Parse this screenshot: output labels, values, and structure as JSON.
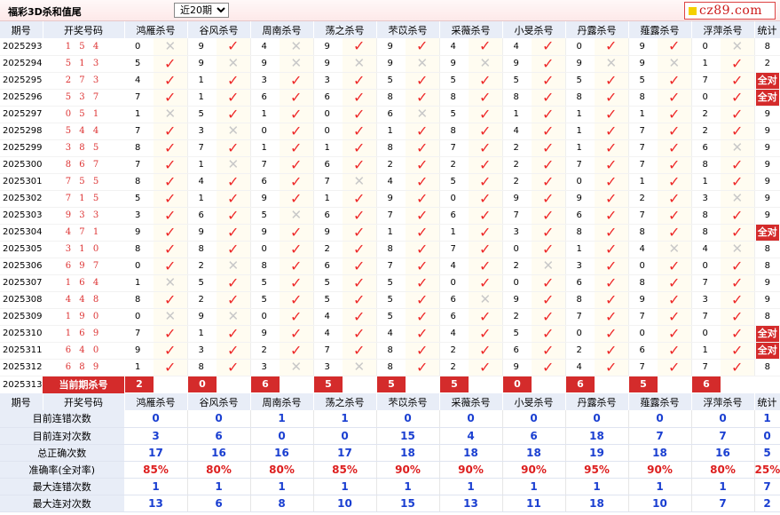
{
  "header": {
    "title": "福彩3D杀和值尾",
    "period_selected": "近20期",
    "logo_text": "cz89.com"
  },
  "columns": {
    "issue": "期号",
    "draw": "开奖号码",
    "killers": [
      "鸿雁杀号",
      "谷风杀号",
      "周南杀号",
      "荡之杀号",
      "芣苡杀号",
      "采薇杀号",
      "小旻杀号",
      "丹露杀号",
      "薤露杀号",
      "浮萍杀号"
    ],
    "total": "统计"
  },
  "rows": [
    {
      "issue": "2025293",
      "draw": "1 5 4",
      "kills": [
        [
          0,
          0
        ],
        [
          9,
          1
        ],
        [
          4,
          0
        ],
        [
          9,
          1
        ],
        [
          9,
          1
        ],
        [
          4,
          1
        ],
        [
          4,
          1
        ],
        [
          0,
          1
        ],
        [
          9,
          1
        ],
        [
          0,
          0
        ]
      ],
      "total": "8"
    },
    {
      "issue": "2025294",
      "draw": "5 1 3",
      "kills": [
        [
          5,
          1
        ],
        [
          9,
          0
        ],
        [
          9,
          0
        ],
        [
          9,
          0
        ],
        [
          9,
          0
        ],
        [
          9,
          0
        ],
        [
          9,
          1
        ],
        [
          9,
          0
        ],
        [
          9,
          0
        ],
        [
          1,
          1
        ]
      ],
      "total": "2"
    },
    {
      "issue": "2025295",
      "draw": "2 7 3",
      "kills": [
        [
          4,
          1
        ],
        [
          1,
          1
        ],
        [
          3,
          1
        ],
        [
          3,
          1
        ],
        [
          5,
          1
        ],
        [
          5,
          1
        ],
        [
          5,
          1
        ],
        [
          5,
          1
        ],
        [
          5,
          1
        ],
        [
          7,
          1
        ]
      ],
      "total": "全对"
    },
    {
      "issue": "2025296",
      "draw": "5 3 7",
      "kills": [
        [
          7,
          1
        ],
        [
          1,
          1
        ],
        [
          6,
          1
        ],
        [
          6,
          1
        ],
        [
          8,
          1
        ],
        [
          8,
          1
        ],
        [
          8,
          1
        ],
        [
          8,
          1
        ],
        [
          8,
          1
        ],
        [
          0,
          1
        ]
      ],
      "total": "全对"
    },
    {
      "issue": "2025297",
      "draw": "0 5 1",
      "kills": [
        [
          1,
          0
        ],
        [
          5,
          1
        ],
        [
          1,
          1
        ],
        [
          0,
          1
        ],
        [
          6,
          0
        ],
        [
          5,
          1
        ],
        [
          1,
          1
        ],
        [
          1,
          1
        ],
        [
          1,
          1
        ],
        [
          2,
          1
        ]
      ],
      "total": "9"
    },
    {
      "issue": "2025298",
      "draw": "5 4 4",
      "kills": [
        [
          7,
          1
        ],
        [
          3,
          0
        ],
        [
          0,
          1
        ],
        [
          0,
          1
        ],
        [
          1,
          1
        ],
        [
          8,
          1
        ],
        [
          4,
          1
        ],
        [
          1,
          1
        ],
        [
          7,
          1
        ],
        [
          2,
          1
        ]
      ],
      "total": "9"
    },
    {
      "issue": "2025299",
      "draw": "3 8 5",
      "kills": [
        [
          8,
          1
        ],
        [
          7,
          1
        ],
        [
          1,
          1
        ],
        [
          1,
          1
        ],
        [
          8,
          1
        ],
        [
          7,
          1
        ],
        [
          2,
          1
        ],
        [
          1,
          1
        ],
        [
          7,
          1
        ],
        [
          6,
          0
        ]
      ],
      "total": "9"
    },
    {
      "issue": "2025300",
      "draw": "8 6 7",
      "kills": [
        [
          7,
          1
        ],
        [
          1,
          0
        ],
        [
          7,
          1
        ],
        [
          6,
          1
        ],
        [
          2,
          1
        ],
        [
          2,
          1
        ],
        [
          2,
          1
        ],
        [
          7,
          1
        ],
        [
          7,
          1
        ],
        [
          8,
          1
        ]
      ],
      "total": "9"
    },
    {
      "issue": "2025301",
      "draw": "7 5 5",
      "kills": [
        [
          8,
          1
        ],
        [
          4,
          1
        ],
        [
          6,
          1
        ],
        [
          7,
          0
        ],
        [
          4,
          1
        ],
        [
          5,
          1
        ],
        [
          2,
          1
        ],
        [
          0,
          1
        ],
        [
          1,
          1
        ],
        [
          1,
          1
        ]
      ],
      "total": "9"
    },
    {
      "issue": "2025302",
      "draw": "7 1 5",
      "kills": [
        [
          5,
          1
        ],
        [
          1,
          1
        ],
        [
          9,
          1
        ],
        [
          1,
          1
        ],
        [
          9,
          1
        ],
        [
          0,
          1
        ],
        [
          9,
          1
        ],
        [
          9,
          1
        ],
        [
          2,
          1
        ],
        [
          3,
          0
        ]
      ],
      "total": "9"
    },
    {
      "issue": "2025303",
      "draw": "9 3 3",
      "kills": [
        [
          3,
          1
        ],
        [
          6,
          1
        ],
        [
          5,
          0
        ],
        [
          6,
          1
        ],
        [
          7,
          1
        ],
        [
          6,
          1
        ],
        [
          7,
          1
        ],
        [
          6,
          1
        ],
        [
          7,
          1
        ],
        [
          8,
          1
        ]
      ],
      "total": "9"
    },
    {
      "issue": "2025304",
      "draw": "4 7 1",
      "kills": [
        [
          9,
          1
        ],
        [
          9,
          1
        ],
        [
          9,
          1
        ],
        [
          9,
          1
        ],
        [
          1,
          1
        ],
        [
          1,
          1
        ],
        [
          3,
          1
        ],
        [
          8,
          1
        ],
        [
          8,
          1
        ],
        [
          8,
          1
        ]
      ],
      "total": "全对"
    },
    {
      "issue": "2025305",
      "draw": "3 1 0",
      "kills": [
        [
          8,
          1
        ],
        [
          8,
          1
        ],
        [
          0,
          1
        ],
        [
          2,
          1
        ],
        [
          8,
          1
        ],
        [
          7,
          1
        ],
        [
          0,
          1
        ],
        [
          1,
          1
        ],
        [
          4,
          0
        ],
        [
          4,
          0
        ]
      ],
      "total": "8"
    },
    {
      "issue": "2025306",
      "draw": "6 9 7",
      "kills": [
        [
          0,
          1
        ],
        [
          2,
          0
        ],
        [
          8,
          1
        ],
        [
          6,
          1
        ],
        [
          7,
          1
        ],
        [
          4,
          1
        ],
        [
          2,
          0
        ],
        [
          3,
          1
        ],
        [
          0,
          1
        ],
        [
          0,
          1
        ]
      ],
      "total": "8"
    },
    {
      "issue": "2025307",
      "draw": "1 6 4",
      "kills": [
        [
          1,
          0
        ],
        [
          5,
          1
        ],
        [
          5,
          1
        ],
        [
          5,
          1
        ],
        [
          5,
          1
        ],
        [
          0,
          1
        ],
        [
          0,
          1
        ],
        [
          6,
          1
        ],
        [
          8,
          1
        ],
        [
          7,
          1
        ]
      ],
      "total": "9"
    },
    {
      "issue": "2025308",
      "draw": "4 4 8",
      "kills": [
        [
          8,
          1
        ],
        [
          2,
          1
        ],
        [
          5,
          1
        ],
        [
          5,
          1
        ],
        [
          5,
          1
        ],
        [
          6,
          0
        ],
        [
          9,
          1
        ],
        [
          8,
          1
        ],
        [
          9,
          1
        ],
        [
          3,
          1
        ]
      ],
      "total": "9"
    },
    {
      "issue": "2025309",
      "draw": "1 9 0",
      "kills": [
        [
          0,
          0
        ],
        [
          9,
          0
        ],
        [
          0,
          1
        ],
        [
          4,
          1
        ],
        [
          5,
          1
        ],
        [
          6,
          1
        ],
        [
          2,
          1
        ],
        [
          7,
          1
        ],
        [
          7,
          1
        ],
        [
          7,
          1
        ]
      ],
      "total": "8"
    },
    {
      "issue": "2025310",
      "draw": "1 6 9",
      "kills": [
        [
          7,
          1
        ],
        [
          1,
          1
        ],
        [
          9,
          1
        ],
        [
          4,
          1
        ],
        [
          4,
          1
        ],
        [
          4,
          1
        ],
        [
          5,
          1
        ],
        [
          0,
          1
        ],
        [
          0,
          1
        ],
        [
          0,
          1
        ]
      ],
      "total": "全对"
    },
    {
      "issue": "2025311",
      "draw": "6 4 0",
      "kills": [
        [
          9,
          1
        ],
        [
          3,
          1
        ],
        [
          2,
          1
        ],
        [
          7,
          1
        ],
        [
          8,
          1
        ],
        [
          2,
          1
        ],
        [
          6,
          1
        ],
        [
          2,
          1
        ],
        [
          6,
          1
        ],
        [
          1,
          1
        ]
      ],
      "total": "全对"
    },
    {
      "issue": "2025312",
      "draw": "6 8 9",
      "kills": [
        [
          1,
          1
        ],
        [
          8,
          1
        ],
        [
          3,
          0
        ],
        [
          3,
          0
        ],
        [
          8,
          1
        ],
        [
          2,
          1
        ],
        [
          9,
          1
        ],
        [
          4,
          1
        ],
        [
          7,
          1
        ],
        [
          7,
          1
        ]
      ],
      "total": "8"
    }
  ],
  "current": {
    "issue": "2025313",
    "label": "当前期杀号",
    "kills": [
      "2",
      "0",
      "6",
      "5",
      "5",
      "5",
      "0",
      "6",
      "5",
      "6"
    ]
  },
  "stats_header": {
    "issue": "期号",
    "draw": "开奖号码",
    "killers": [
      "鸿雁杀号",
      "谷风杀号",
      "周南杀号",
      "荡之杀号",
      "芣苡杀号",
      "采薇杀号",
      "小旻杀号",
      "丹露杀号",
      "薤露杀号",
      "浮萍杀号"
    ],
    "total": "统计"
  },
  "stats": [
    {
      "label": "目前连错次数",
      "values": [
        "0",
        "0",
        "1",
        "1",
        "0",
        "0",
        "0",
        "0",
        "0",
        "0"
      ],
      "total": "1",
      "pct": false
    },
    {
      "label": "目前连对次数",
      "values": [
        "3",
        "6",
        "0",
        "0",
        "15",
        "4",
        "6",
        "18",
        "7",
        "7"
      ],
      "total": "0",
      "pct": false
    },
    {
      "label": "总正确次数",
      "values": [
        "17",
        "16",
        "16",
        "17",
        "18",
        "18",
        "18",
        "19",
        "18",
        "16"
      ],
      "total": "5",
      "pct": false
    },
    {
      "label": "准确率(全对率)",
      "values": [
        "85%",
        "80%",
        "80%",
        "85%",
        "90%",
        "90%",
        "90%",
        "95%",
        "90%",
        "80%"
      ],
      "total": "25%",
      "pct": true
    },
    {
      "label": "最大连错次数",
      "values": [
        "1",
        "1",
        "1",
        "1",
        "1",
        "1",
        "1",
        "1",
        "1",
        "1"
      ],
      "total": "7",
      "pct": false
    },
    {
      "label": "最大连对次数",
      "values": [
        "13",
        "6",
        "8",
        "10",
        "15",
        "13",
        "11",
        "18",
        "10",
        "7"
      ],
      "total": "2",
      "pct": false
    }
  ],
  "marks": {
    "ok": "✓",
    "bad": "✕"
  },
  "colors": {
    "accent_red": "#d42b2b",
    "header_bg": "#e8edf7",
    "stat_blue": "#1a3fd1"
  }
}
